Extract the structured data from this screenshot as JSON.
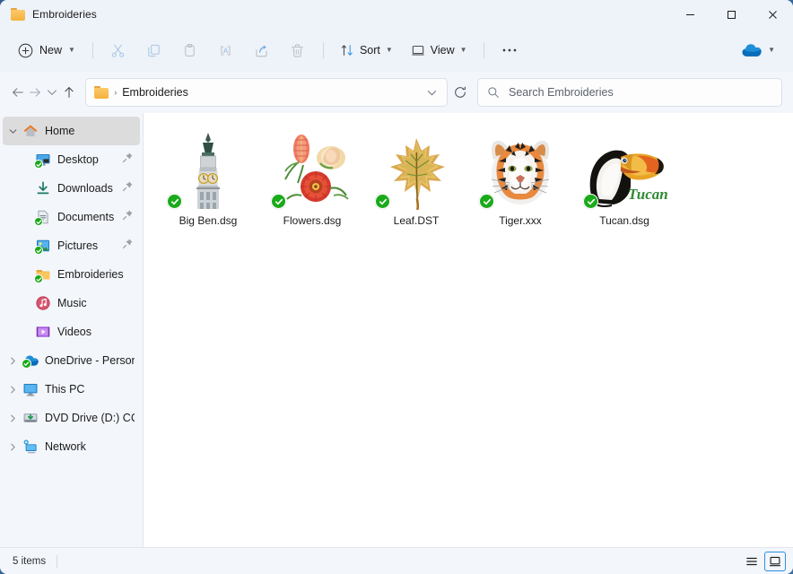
{
  "window": {
    "title": "Embroideries",
    "controls": {
      "minimize": "Minimize",
      "maximize": "Maximize",
      "close": "Close"
    }
  },
  "toolbar": {
    "new_label": "New",
    "cut_label": "Cut",
    "copy_label": "Copy",
    "paste_label": "Paste",
    "rename_label": "Rename",
    "share_label": "Share",
    "delete_label": "Delete",
    "sort_label": "Sort",
    "view_label": "View",
    "more_label": "See more",
    "onedrive_label": "OneDrive sync status"
  },
  "navbar": {
    "back_label": "Back",
    "forward_label": "Forward",
    "recent_label": "Recent locations",
    "up_label": "Up to Home",
    "refresh_label": "Refresh",
    "breadcrumb": [
      "Embroideries"
    ],
    "breadcrumb_separator": "›"
  },
  "search": {
    "placeholder": "Search Embroideries",
    "value": ""
  },
  "sidebar": {
    "items": [
      {
        "label": "Home",
        "icon": "home-icon",
        "twisty": "expanded",
        "level": 0,
        "selected": true,
        "pinned": false
      },
      {
        "label": "Desktop",
        "icon": "desktop-icon",
        "twisty": "none",
        "level": 1,
        "selected": false,
        "pinned": true
      },
      {
        "label": "Downloads",
        "icon": "downloads-icon",
        "twisty": "none",
        "level": 1,
        "selected": false,
        "pinned": true
      },
      {
        "label": "Documents",
        "icon": "documents-icon",
        "twisty": "none",
        "level": 1,
        "selected": false,
        "pinned": true
      },
      {
        "label": "Pictures",
        "icon": "pictures-icon",
        "twisty": "none",
        "level": 1,
        "selected": false,
        "pinned": true
      },
      {
        "label": "Embroideries",
        "icon": "folder-icon",
        "twisty": "none",
        "level": 1,
        "selected": false,
        "pinned": false
      },
      {
        "label": "Music",
        "icon": "music-icon",
        "twisty": "none",
        "level": 1,
        "selected": false,
        "pinned": false
      },
      {
        "label": "Videos",
        "icon": "videos-icon",
        "twisty": "none",
        "level": 1,
        "selected": false,
        "pinned": false
      },
      {
        "label": "OneDrive - Personal",
        "icon": "onedrive-icon",
        "twisty": "collapsed",
        "level": 0,
        "selected": false,
        "pinned": false
      },
      {
        "label": "This PC",
        "icon": "thispc-icon",
        "twisty": "collapsed",
        "level": 0,
        "selected": false,
        "pinned": false
      },
      {
        "label": "DVD Drive (D:) CCCO",
        "icon": "dvd-icon",
        "twisty": "collapsed",
        "level": 0,
        "selected": false,
        "pinned": false
      },
      {
        "label": "Network",
        "icon": "network-icon",
        "twisty": "collapsed",
        "level": 0,
        "selected": false,
        "pinned": false
      }
    ]
  },
  "files": [
    {
      "name": "Big Ben.dsg",
      "thumb": "big-ben-embroidery",
      "synced": true
    },
    {
      "name": "Flowers.dsg",
      "thumb": "flowers-embroidery",
      "synced": true
    },
    {
      "name": "Leaf.DST",
      "thumb": "leaf-embroidery",
      "synced": true
    },
    {
      "name": "Tiger.xxx",
      "thumb": "tiger-embroidery",
      "synced": true
    },
    {
      "name": "Tucan.dsg",
      "thumb": "tucan-embroidery",
      "synced": true
    }
  ],
  "statusbar": {
    "item_count": "5 items",
    "details_view_label": "Details view",
    "large_icons_view_label": "Large icons view",
    "active_view": "large-icons"
  },
  "colors": {
    "accent": "#2a8fe0",
    "chrome": "#eef2f9",
    "pane": "#f3f6fb",
    "content": "#ffffff",
    "sync_green": "#1aaa1a",
    "folder_yellow": "#f4b23c"
  }
}
